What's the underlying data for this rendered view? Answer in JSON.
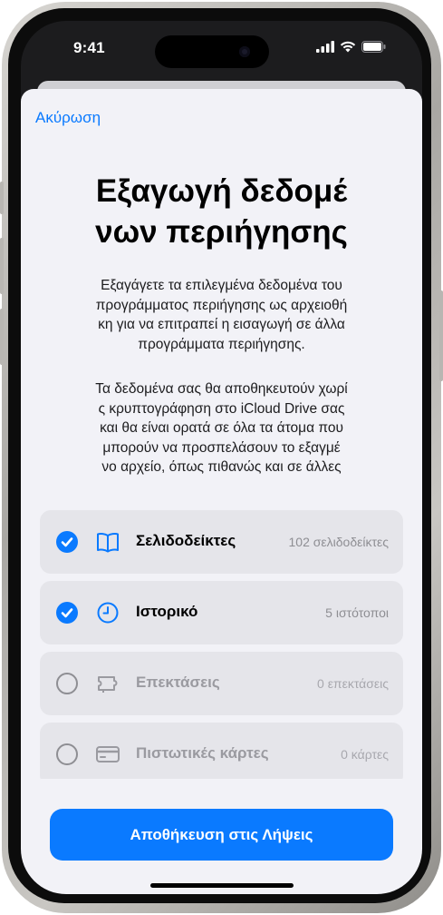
{
  "status": {
    "time": "9:41"
  },
  "sheet": {
    "cancel": "Ακύρωση",
    "title_line1": "Εξαγωγή δεδομέ",
    "title_line2": "νων περιήγησης",
    "desc1": [
      "Εξαγάγετε τα επιλεγμένα δεδομένα του",
      "προγράμματος περιήγησης ως αρχειοθή",
      "κη για να επιτραπεί η εισαγωγή σε άλλα",
      "προγράμματα περιήγησης."
    ],
    "desc2": [
      "Τα δεδομένα σας θα αποθηκευτούν χωρί",
      "ς κρυπτογράφηση στο iCloud Drive σας",
      "και θα είναι ορατά σε όλα τα άτομα που",
      "μπορούν να προσπελάσουν το εξαγμέ",
      "νο αρχείο, όπως πιθανώς και σε άλλες"
    ],
    "options": [
      {
        "label": "Σελιδοδείκτες",
        "count": "102 σελιδοδείκτες",
        "checked": true,
        "icon": "book-icon"
      },
      {
        "label": "Ιστορικό",
        "count": "5 ιστότοποι",
        "checked": true,
        "icon": "clock-icon"
      },
      {
        "label": "Επεκτάσεις",
        "count": "0 επεκτάσεις",
        "checked": false,
        "icon": "puzzle-icon"
      },
      {
        "label": "Πιστωτικές κάρτες",
        "count": "0 κάρτες",
        "checked": false,
        "icon": "credit-card-icon"
      }
    ],
    "save_button": "Αποθήκευση στις Λήψεις"
  },
  "colors": {
    "accent": "#0a7aff",
    "sheet_bg": "#f2f2f7",
    "row_bg": "#e5e5ea"
  }
}
